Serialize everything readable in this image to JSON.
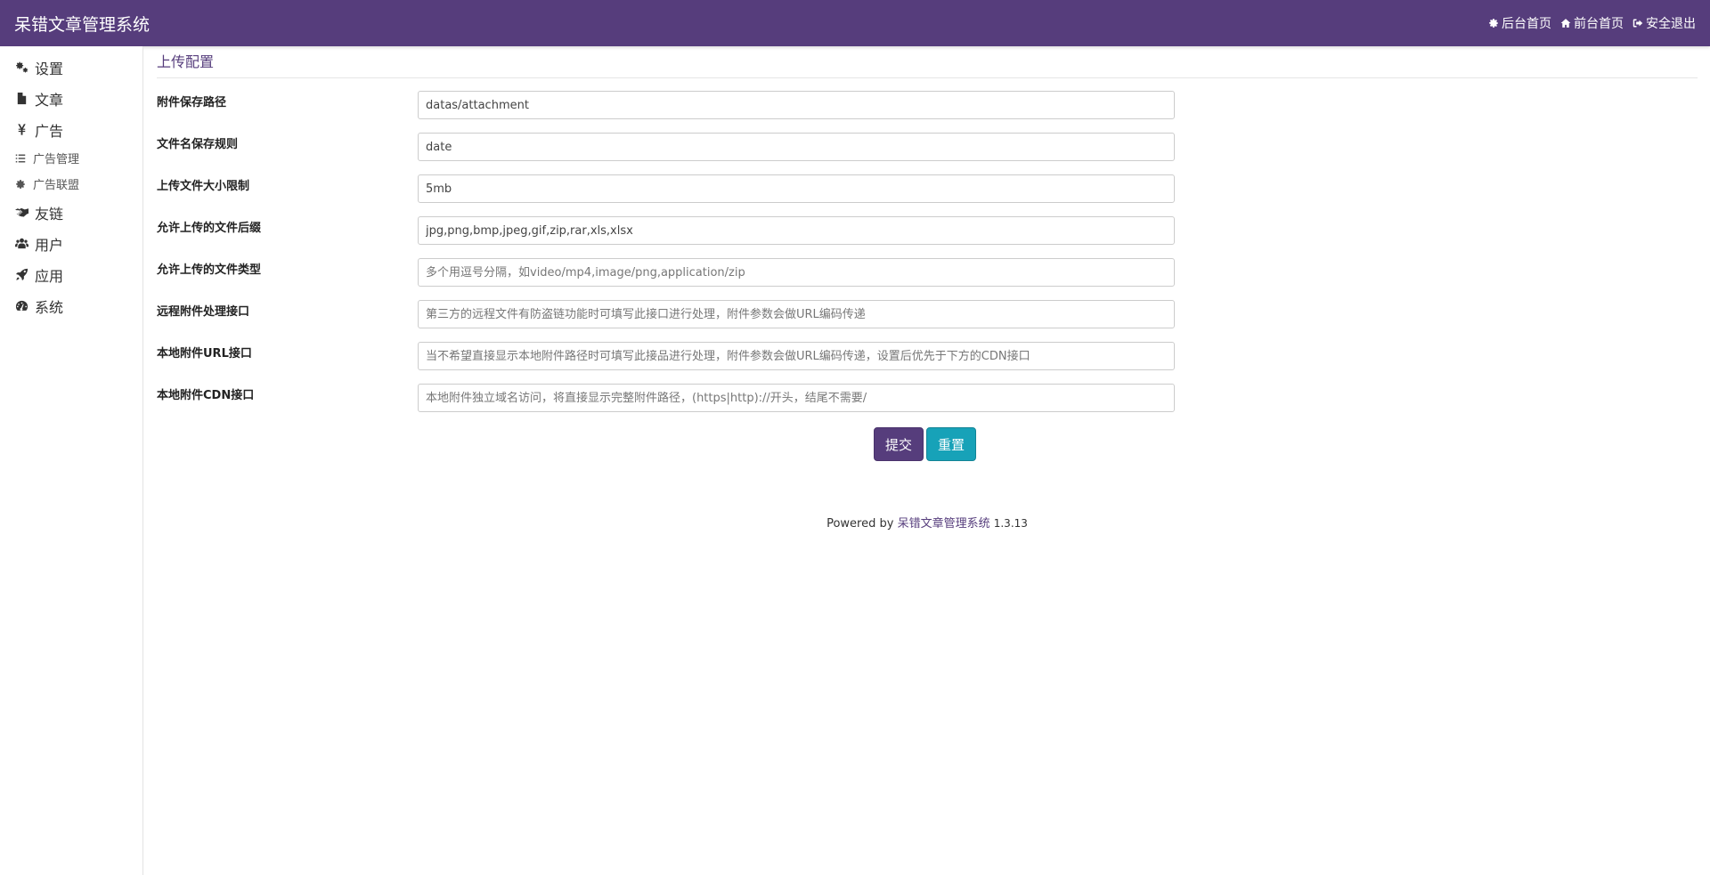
{
  "header": {
    "brand": "呆错文章管理系统",
    "links": [
      {
        "label": "后台首页",
        "icon": "gear-icon"
      },
      {
        "label": "前台首页",
        "icon": "home-icon"
      },
      {
        "label": "安全退出",
        "icon": "sign-out-icon"
      }
    ]
  },
  "sidebar": {
    "items": [
      {
        "label": "设置",
        "icon": "gears-icon"
      },
      {
        "label": "文章",
        "icon": "file-icon"
      },
      {
        "label": "广告",
        "icon": "yen-icon"
      },
      {
        "label": "广告管理",
        "icon": "list-icon"
      },
      {
        "label": "广告联盟",
        "icon": "gear-icon"
      },
      {
        "label": "友链",
        "icon": "handshake-icon"
      },
      {
        "label": "用户",
        "icon": "users-icon"
      },
      {
        "label": "应用",
        "icon": "rocket-icon"
      },
      {
        "label": "系统",
        "icon": "dashboard-icon"
      }
    ]
  },
  "main": {
    "section_title": "上传配置",
    "fields": [
      {
        "label": "附件保存路径",
        "value": "datas/attachment",
        "placeholder": ""
      },
      {
        "label": "文件名保存规则",
        "value": "date",
        "placeholder": ""
      },
      {
        "label": "上传文件大小限制",
        "value": "5mb",
        "placeholder": ""
      },
      {
        "label": "允许上传的文件后缀",
        "value": "jpg,png,bmp,jpeg,gif,zip,rar,xls,xlsx",
        "placeholder": ""
      },
      {
        "label": "允许上传的文件类型",
        "value": "",
        "placeholder": "多个用逗号分隔，如video/mp4,image/png,application/zip"
      },
      {
        "label": "远程附件处理接口",
        "value": "",
        "placeholder": "第三方的远程文件有防盗链功能时可填写此接口进行处理，附件参数会做URL编码传递"
      },
      {
        "label": "本地附件URL接口",
        "value": "",
        "placeholder": "当不希望直接显示本地附件路径时可填写此接品进行处理，附件参数会做URL编码传递，设置后优先于下方的CDN接口"
      },
      {
        "label": "本地附件CDN接口",
        "value": "",
        "placeholder": "本地附件独立域名访问，将直接显示完整附件路径，(https|http)://开头，结尾不需要/"
      }
    ],
    "submit_label": "提交",
    "reset_label": "重置"
  },
  "footer": {
    "powered_by": "Powered by",
    "product": "呆错文章管理系统",
    "version": "1.3.13"
  },
  "colors": {
    "brand": "#563d7c",
    "info": "#17a2b8"
  }
}
